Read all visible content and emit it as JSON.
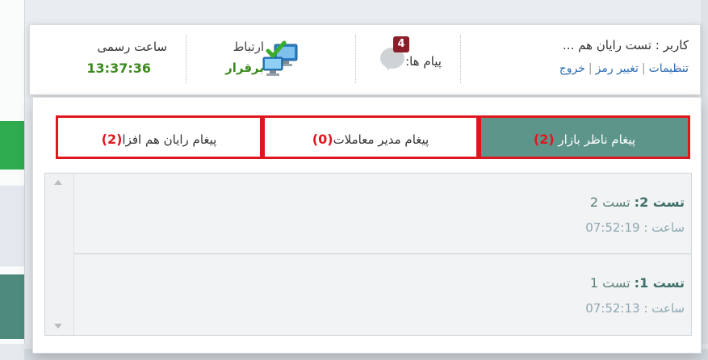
{
  "header": {
    "user_line": "کاربر : تست رایان هم ...",
    "settings_link": "تنظیمات",
    "change_password_link": "تغییر رمز",
    "logout_link": "خروج",
    "messages_label": "پیام ها:",
    "messages_count": "4",
    "connection_label": "ارتباط",
    "connection_status": "برقرار",
    "official_time_label": "ساعت رسمی",
    "official_time": "13:37:36"
  },
  "tabs": [
    {
      "label": "پیغام ناظر بازار ",
      "count": "(2)",
      "active": true
    },
    {
      "label": "پیغام مدیر معاملات",
      "count": "(0)",
      "active": false
    },
    {
      "label": "پیغام رایان هم افزا",
      "count": "(2)",
      "active": false
    }
  ],
  "messages": [
    {
      "title_bold": "تست 2:",
      "title_rest": " تست 2",
      "time_prefix": "ساعت : ",
      "time": "07:52:19"
    },
    {
      "title_bold": "تست 1:",
      "title_rest": " تست 1",
      "time_prefix": "ساعت : ",
      "time": "07:52:13"
    }
  ],
  "colors": {
    "active_tab": "#5e958a",
    "tab_border": "#e0161f",
    "status_green": "#3c8a1e",
    "badge": "#8b1e2b",
    "link": "#2a6bb0"
  },
  "icons": {
    "message": "chat-bubble-icon",
    "connection": "network-connected-icon",
    "scroll_up": "chevron-up-icon",
    "scroll_down": "chevron-down-icon"
  }
}
